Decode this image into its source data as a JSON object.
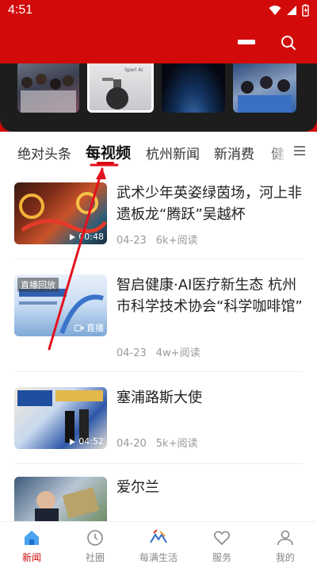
{
  "status_bar": {
    "time": "4:51"
  },
  "header": {
    "menu_icon": "minus-icon",
    "search_icon": "search-icon"
  },
  "carousel": {
    "items": [
      {
        "name": "carousel-item-crowd"
      },
      {
        "name": "carousel-item-robot-arm",
        "tag": "Sperl AI"
      },
      {
        "name": "carousel-item-earth-space"
      },
      {
        "name": "carousel-item-students"
      }
    ]
  },
  "tabs": [
    {
      "label": "绝对头条"
    },
    {
      "label": "每视频",
      "active": true
    },
    {
      "label": "杭州新闻"
    },
    {
      "label": "新消费"
    },
    {
      "label": "健"
    }
  ],
  "news": [
    {
      "title": "武术少年英姿绿茵场，河上非遗板龙“腾跃”吴越杯",
      "date": "04-23",
      "reads": "6k+阅读",
      "duration": "00:48",
      "badge": ""
    },
    {
      "title": "智启健康·AI医疗新生态 杭州市科学技术协会“科学咖啡馆”",
      "date": "04-23",
      "reads": "4w+阅读",
      "duration": "直播",
      "badge": "直播回放"
    },
    {
      "title": "塞浦路斯大使",
      "date": "04-20",
      "reads": "5k+阅读",
      "duration": "04:52",
      "badge": ""
    },
    {
      "title": "爱尔兰",
      "date": "",
      "reads": "",
      "duration": "",
      "badge": ""
    }
  ],
  "bottom_nav": [
    {
      "label": "新闻",
      "icon": "home-icon",
      "active": true
    },
    {
      "label": "社圈",
      "icon": "clock-icon",
      "active": false
    },
    {
      "label": "每满生活",
      "icon": "logo-icon",
      "active": false
    },
    {
      "label": "服务",
      "icon": "heart-icon",
      "active": false
    },
    {
      "label": "我的",
      "icon": "user-icon",
      "active": false
    }
  ],
  "colors": {
    "brand": "#d20a0a",
    "annotation": "#e4101e"
  }
}
